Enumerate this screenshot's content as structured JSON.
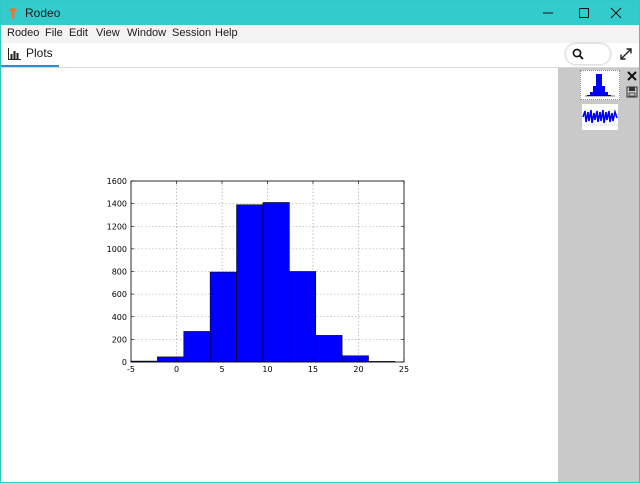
{
  "window": {
    "title": "Rodeo",
    "accent": "#33cccc"
  },
  "menubar": {
    "items": [
      "Rodeo",
      "File",
      "Edit",
      "View",
      "Window",
      "Session",
      "Help"
    ]
  },
  "tabs": {
    "plots_label": "Plots"
  },
  "icons": {
    "app": "rodeo-icon",
    "minimize": "minimize-icon",
    "maximize": "maximize-icon",
    "close": "close-icon",
    "plots": "bar-chart-icon",
    "search": "search-icon",
    "expand": "expand-icon",
    "delete": "close-icon",
    "save": "save-icon"
  },
  "chart_data": {
    "type": "bar",
    "title": "",
    "xlabel": "",
    "ylabel": "",
    "bins": [
      {
        "x0": -5,
        "x1": -2.1,
        "count": 8
      },
      {
        "x0": -2.1,
        "x1": 0.8,
        "count": 45
      },
      {
        "x0": 0.8,
        "x1": 3.7,
        "count": 270
      },
      {
        "x0": 3.7,
        "x1": 6.6,
        "count": 795
      },
      {
        "x0": 6.6,
        "x1": 9.5,
        "count": 1390
      },
      {
        "x0": 9.5,
        "x1": 12.4,
        "count": 1410
      },
      {
        "x0": 12.4,
        "x1": 15.3,
        "count": 800
      },
      {
        "x0": 15.3,
        "x1": 18.2,
        "count": 235
      },
      {
        "x0": 18.2,
        "x1": 21.1,
        "count": 55
      },
      {
        "x0": 21.1,
        "x1": 24.0,
        "count": 5
      }
    ],
    "xlim": [
      -5,
      25
    ],
    "ylim": [
      0,
      1600
    ],
    "xticks": [
      "-5",
      "0",
      "5",
      "10",
      "15",
      "20",
      "25"
    ],
    "yticks": [
      "0",
      "200",
      "400",
      "600",
      "800",
      "1000",
      "1200",
      "1400",
      "1600"
    ],
    "grid": true,
    "bar_color": "#0000ff"
  }
}
